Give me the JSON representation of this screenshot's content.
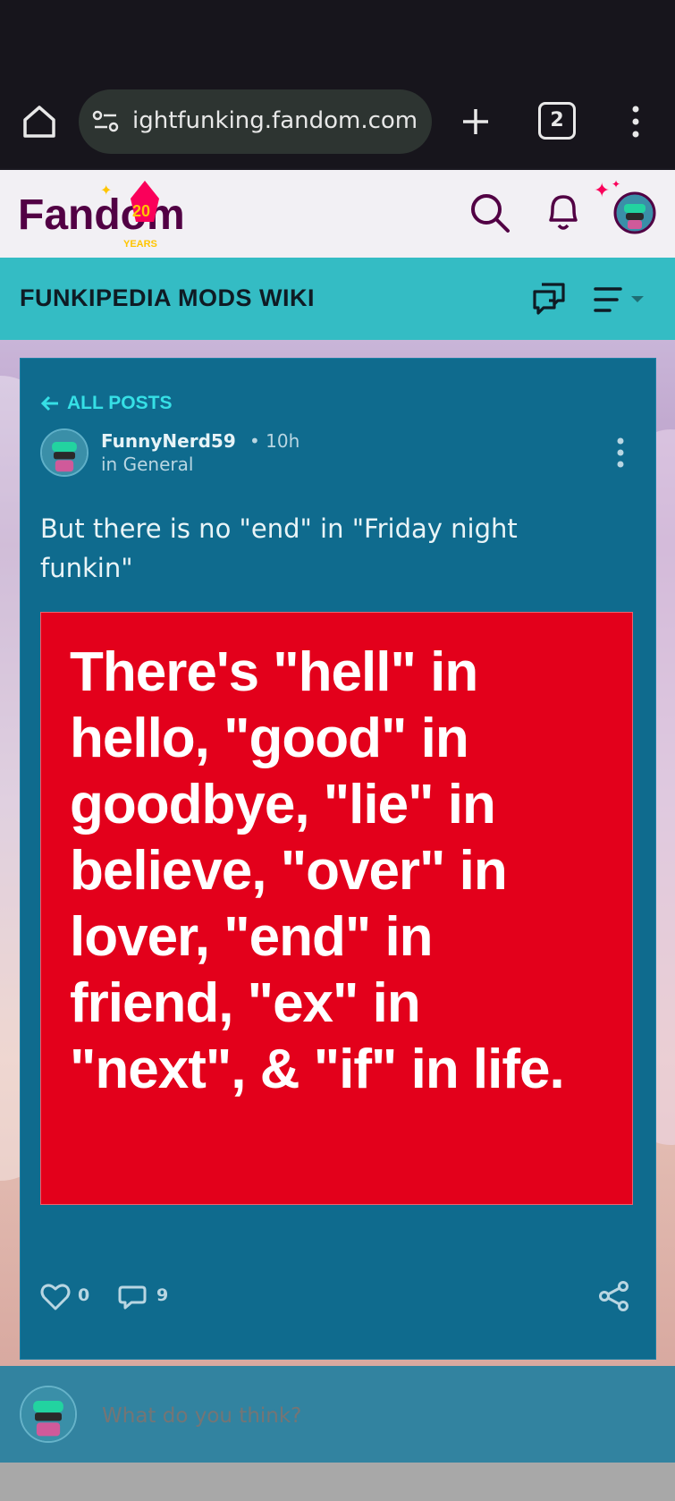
{
  "browser": {
    "url": "ightfunking.fandom.com",
    "tab_count": "2",
    "icons": [
      "home-icon",
      "site-settings-icon",
      "new-tab-icon",
      "tab-switcher-icon",
      "overflow-menu-icon"
    ]
  },
  "fandom_header": {
    "logo_text": "Fandom",
    "logo_badge": "20",
    "logo_sub": "YEARS",
    "icons": [
      "search-icon",
      "bell-icon",
      "user-avatar"
    ]
  },
  "wiki": {
    "title": "FUNKIPEDIA MODS WIKI",
    "icons": [
      "discussions-icon",
      "hamburger-menu-icon"
    ]
  },
  "post": {
    "back_label": "ALL POSTS",
    "author": "FunnyNerd59",
    "time": "10h",
    "category": "in General",
    "body": "But there is no \"end\" in \"Friday night funkin\"",
    "image_text": "There's \"hell\" in hello, \"good\" in goodbye, \"lie\" in believe, \"over\" in lover, \"end\" in friend, \"ex\" in \"next\", & \"if\" in life.",
    "likes": "0",
    "comments": "9"
  },
  "composer": {
    "placeholder": "What do you think?"
  },
  "colors": {
    "accent_cyan": "#34bcc4",
    "card_bg": "#0f6b8e",
    "image_red": "#e3001b",
    "fandom_purple": "#520044"
  }
}
